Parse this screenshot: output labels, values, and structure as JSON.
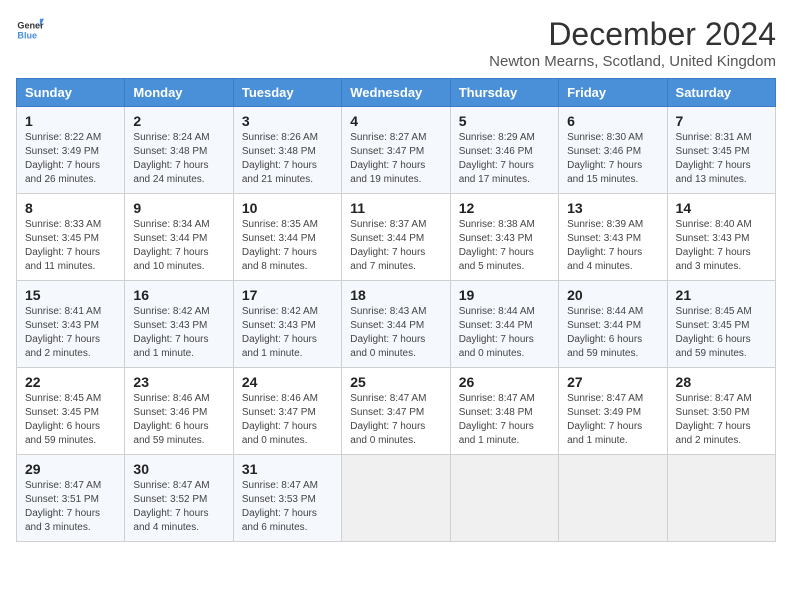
{
  "header": {
    "logo_general": "General",
    "logo_blue": "Blue",
    "month_title": "December 2024",
    "location": "Newton Mearns, Scotland, United Kingdom"
  },
  "days_of_week": [
    "Sunday",
    "Monday",
    "Tuesday",
    "Wednesday",
    "Thursday",
    "Friday",
    "Saturday"
  ],
  "weeks": [
    [
      {
        "day": "1",
        "sunrise": "8:22 AM",
        "sunset": "3:49 PM",
        "daylight": "7 hours and 26 minutes."
      },
      {
        "day": "2",
        "sunrise": "8:24 AM",
        "sunset": "3:48 PM",
        "daylight": "7 hours and 24 minutes."
      },
      {
        "day": "3",
        "sunrise": "8:26 AM",
        "sunset": "3:48 PM",
        "daylight": "7 hours and 21 minutes."
      },
      {
        "day": "4",
        "sunrise": "8:27 AM",
        "sunset": "3:47 PM",
        "daylight": "7 hours and 19 minutes."
      },
      {
        "day": "5",
        "sunrise": "8:29 AM",
        "sunset": "3:46 PM",
        "daylight": "7 hours and 17 minutes."
      },
      {
        "day": "6",
        "sunrise": "8:30 AM",
        "sunset": "3:46 PM",
        "daylight": "7 hours and 15 minutes."
      },
      {
        "day": "7",
        "sunrise": "8:31 AM",
        "sunset": "3:45 PM",
        "daylight": "7 hours and 13 minutes."
      }
    ],
    [
      {
        "day": "8",
        "sunrise": "8:33 AM",
        "sunset": "3:45 PM",
        "daylight": "7 hours and 11 minutes."
      },
      {
        "day": "9",
        "sunrise": "8:34 AM",
        "sunset": "3:44 PM",
        "daylight": "7 hours and 10 minutes."
      },
      {
        "day": "10",
        "sunrise": "8:35 AM",
        "sunset": "3:44 PM",
        "daylight": "7 hours and 8 minutes."
      },
      {
        "day": "11",
        "sunrise": "8:37 AM",
        "sunset": "3:44 PM",
        "daylight": "7 hours and 7 minutes."
      },
      {
        "day": "12",
        "sunrise": "8:38 AM",
        "sunset": "3:43 PM",
        "daylight": "7 hours and 5 minutes."
      },
      {
        "day": "13",
        "sunrise": "8:39 AM",
        "sunset": "3:43 PM",
        "daylight": "7 hours and 4 minutes."
      },
      {
        "day": "14",
        "sunrise": "8:40 AM",
        "sunset": "3:43 PM",
        "daylight": "7 hours and 3 minutes."
      }
    ],
    [
      {
        "day": "15",
        "sunrise": "8:41 AM",
        "sunset": "3:43 PM",
        "daylight": "7 hours and 2 minutes."
      },
      {
        "day": "16",
        "sunrise": "8:42 AM",
        "sunset": "3:43 PM",
        "daylight": "7 hours and 1 minute."
      },
      {
        "day": "17",
        "sunrise": "8:42 AM",
        "sunset": "3:43 PM",
        "daylight": "7 hours and 1 minute."
      },
      {
        "day": "18",
        "sunrise": "8:43 AM",
        "sunset": "3:44 PM",
        "daylight": "7 hours and 0 minutes."
      },
      {
        "day": "19",
        "sunrise": "8:44 AM",
        "sunset": "3:44 PM",
        "daylight": "7 hours and 0 minutes."
      },
      {
        "day": "20",
        "sunrise": "8:44 AM",
        "sunset": "3:44 PM",
        "daylight": "6 hours and 59 minutes."
      },
      {
        "day": "21",
        "sunrise": "8:45 AM",
        "sunset": "3:45 PM",
        "daylight": "6 hours and 59 minutes."
      }
    ],
    [
      {
        "day": "22",
        "sunrise": "8:45 AM",
        "sunset": "3:45 PM",
        "daylight": "6 hours and 59 minutes."
      },
      {
        "day": "23",
        "sunrise": "8:46 AM",
        "sunset": "3:46 PM",
        "daylight": "6 hours and 59 minutes."
      },
      {
        "day": "24",
        "sunrise": "8:46 AM",
        "sunset": "3:47 PM",
        "daylight": "7 hours and 0 minutes."
      },
      {
        "day": "25",
        "sunrise": "8:47 AM",
        "sunset": "3:47 PM",
        "daylight": "7 hours and 0 minutes."
      },
      {
        "day": "26",
        "sunrise": "8:47 AM",
        "sunset": "3:48 PM",
        "daylight": "7 hours and 1 minute."
      },
      {
        "day": "27",
        "sunrise": "8:47 AM",
        "sunset": "3:49 PM",
        "daylight": "7 hours and 1 minute."
      },
      {
        "day": "28",
        "sunrise": "8:47 AM",
        "sunset": "3:50 PM",
        "daylight": "7 hours and 2 minutes."
      }
    ],
    [
      {
        "day": "29",
        "sunrise": "8:47 AM",
        "sunset": "3:51 PM",
        "daylight": "7 hours and 3 minutes."
      },
      {
        "day": "30",
        "sunrise": "8:47 AM",
        "sunset": "3:52 PM",
        "daylight": "7 hours and 4 minutes."
      },
      {
        "day": "31",
        "sunrise": "8:47 AM",
        "sunset": "3:53 PM",
        "daylight": "7 hours and 6 minutes."
      },
      null,
      null,
      null,
      null
    ]
  ]
}
